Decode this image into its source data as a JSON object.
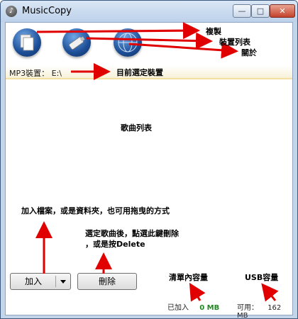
{
  "window": {
    "title": "MusicCopy",
    "controls": {
      "minimize": "—",
      "maximize": "□",
      "close": "✕"
    }
  },
  "toolbar": {
    "buttons": [
      {
        "name": "copy",
        "icon": "documents-icon"
      },
      {
        "name": "device-list",
        "icon": "usb-drive-icon"
      },
      {
        "name": "about",
        "icon": "globe-icon"
      }
    ]
  },
  "device": {
    "label": "MP3裝置：",
    "value": "E:\\"
  },
  "actions": {
    "add_label": "加入",
    "delete_label": "刪除"
  },
  "status": {
    "added_label": "已加入",
    "added_value": "0 MB",
    "available_label": "可用：",
    "available_value": "162 MB"
  },
  "annotations": {
    "copy": "複製",
    "device_list": "裝置列表",
    "about": "關於",
    "current_device": "目前選定裝置",
    "song_list": "歌曲列表",
    "add_hint": "加入檔案，或是資料夾，也可用拖曳的方式",
    "delete_hint_1": "選定歌曲後，點選此鍵刪除",
    "delete_hint_2": "，或是按Delete",
    "list_capacity": "清單內容量",
    "usb_capacity": "USB容量"
  },
  "colors": {
    "annotation_arrow": "#e00000",
    "added_value": "#1f8a1f",
    "device_row_border": "#f3dfa0"
  }
}
